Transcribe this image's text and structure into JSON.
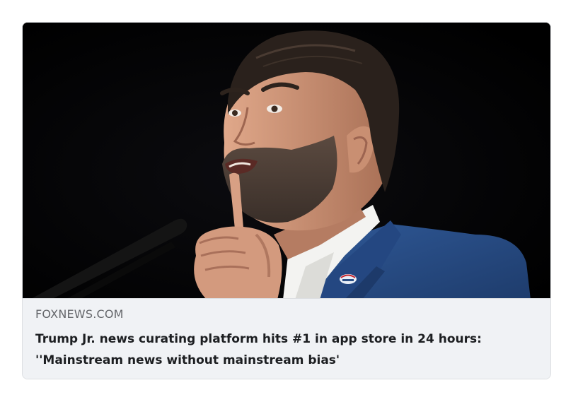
{
  "link_preview": {
    "image_alt": "Man in a blue suit speaking with a raised index finger, dark background",
    "image_colors": {
      "background": "#000000",
      "suit": "#2b4f86",
      "shirt": "#f3f3f1",
      "skin": "#c98f72",
      "hair": "#2a211c"
    },
    "domain": "FOXNEWS.COM",
    "headline": "Trump Jr. news curating platform hits #1 in app store in 24 hours: ''Mainstream news without mainstream bias'"
  }
}
